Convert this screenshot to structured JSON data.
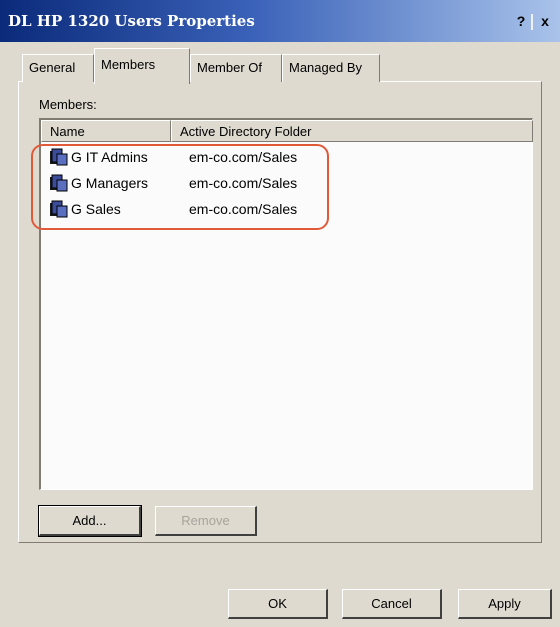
{
  "window": {
    "title": "DL HP 1320 Users Properties",
    "help_label": "?",
    "close_label": "x"
  },
  "tabs": [
    {
      "label": "General"
    },
    {
      "label": "Members"
    },
    {
      "label": "Member Of"
    },
    {
      "label": "Managed By"
    }
  ],
  "members_label": "Members:",
  "list": {
    "columns": [
      "Name",
      "Active Directory Folder"
    ],
    "rows": [
      {
        "name": "G IT Admins",
        "folder": "em-co.com/Sales"
      },
      {
        "name": "G Managers",
        "folder": "em-co.com/Sales"
      },
      {
        "name": "G Sales",
        "folder": "em-co.com/Sales"
      }
    ]
  },
  "buttons": {
    "add": "Add...",
    "remove": "Remove",
    "ok": "OK",
    "cancel": "Cancel",
    "apply": "Apply"
  },
  "icons": {
    "group": "group-icon"
  },
  "colors": {
    "title_bar_start": "#0b2a7a",
    "title_bar_end": "#a9c3ea",
    "highlight": "#e05a3a"
  }
}
